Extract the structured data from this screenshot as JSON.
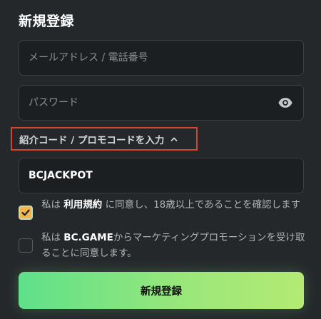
{
  "form": {
    "title": "新規登録",
    "email_placeholder": "メールアドレス / 電話番号",
    "password_placeholder": "パスワード",
    "password_visibility_icon": "eye-icon",
    "referral_toggle_label": "紹介コード / プロモコードを入力",
    "referral_toggle_icon": "chevron-up-icon",
    "referral_code_value": "BCJACKPOT",
    "terms": {
      "checked": true,
      "prefix": "私は ",
      "link": "利用規約",
      "suffix": " に同意し、18歳以上であることを確認します"
    },
    "marketing": {
      "checked": false,
      "prefix": "私は ",
      "brand": "BC.GAME",
      "suffix": "からマーケティングプロモーションを受け取ることに同意します。"
    },
    "submit_label": "新規登録"
  },
  "colors": {
    "background": "#25282b",
    "field_background": "#1c1f22",
    "highlight_border": "#d9452b",
    "checkbox_checked": "#f2b44c",
    "submit_gradient_start": "#5fe08a",
    "submit_gradient_end": "#b4ea73"
  }
}
